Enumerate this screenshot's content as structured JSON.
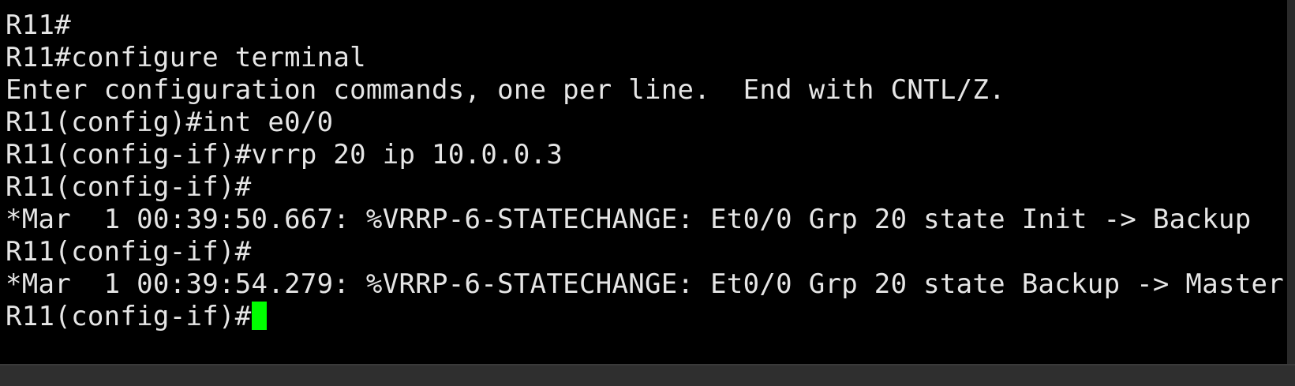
{
  "terminal": {
    "lines": [
      "R11#",
      "R11#configure terminal",
      "Enter configuration commands, one per line.  End with CNTL/Z.",
      "R11(config)#int e0/0",
      "R11(config-if)#vrrp 20 ip 10.0.0.3",
      "R11(config-if)#",
      "*Mar  1 00:39:50.667: %VRRP-6-STATECHANGE: Et0/0 Grp 20 state Init -> Backup",
      "R11(config-if)#",
      "*Mar  1 00:39:54.279: %VRRP-6-STATECHANGE: Et0/0 Grp 20 state Backup -> Master",
      "R11(config-if)#"
    ],
    "cursor_color": "#00ff00",
    "text_color": "#e6e6e6",
    "background_color": "#000000"
  }
}
